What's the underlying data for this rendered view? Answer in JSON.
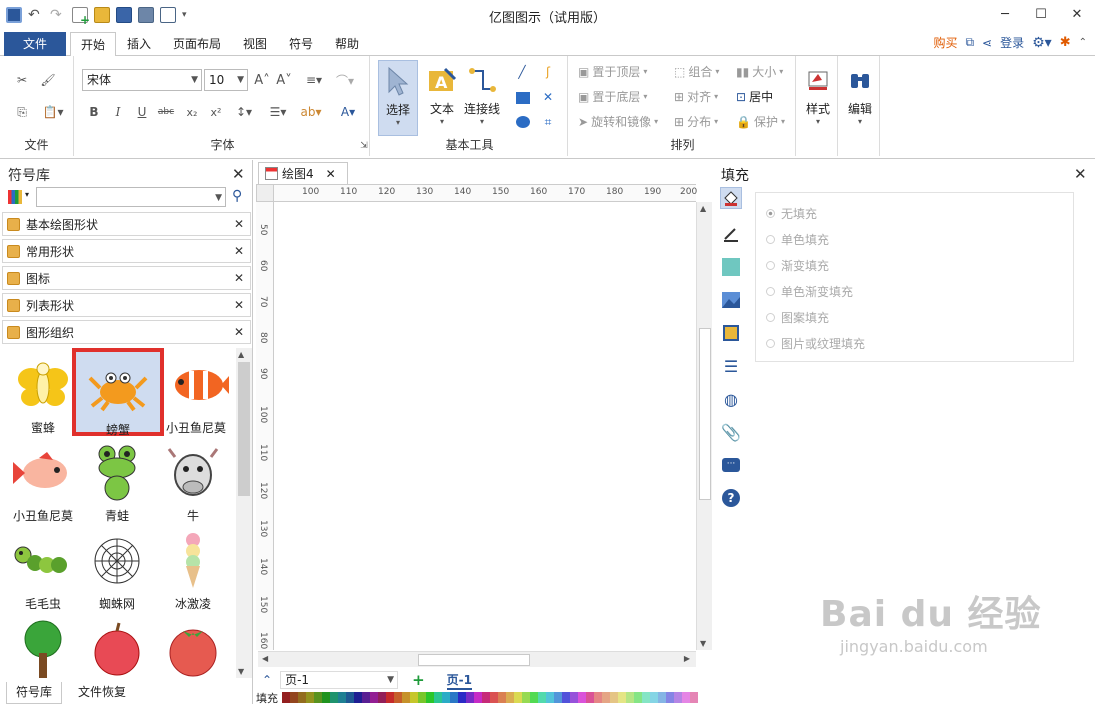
{
  "app": {
    "title": "亿图图示（试用版）"
  },
  "tabs": {
    "file": "文件",
    "home": "开始",
    "insert": "插入",
    "layout": "页面布局",
    "view": "视图",
    "symbol": "符号",
    "help": "帮助"
  },
  "topright": {
    "buy": "购买",
    "login": "登录"
  },
  "ribbon": {
    "file_group": "文件",
    "font_group": "字体",
    "font_name": "宋体",
    "font_size": "10",
    "basic_group": "基本工具",
    "select": "选择",
    "text": "文本",
    "connector": "连接线",
    "arrange_group": "排列",
    "bring_front": "置于顶层",
    "send_back": "置于底层",
    "rotate_mirror": "旋转和镜像",
    "group": "组合",
    "align": "对齐",
    "distribute": "分布",
    "size": "大小",
    "center": "居中",
    "protect": "保护",
    "style": "样式",
    "edit": "编辑"
  },
  "library": {
    "title": "符号库",
    "search_value": "",
    "sections": [
      "基本绘图形状",
      "常用形状",
      "图标",
      "列表形状",
      "图形组织"
    ],
    "shapes": [
      "蜜蜂",
      "螃蟹",
      "小丑鱼尼莫",
      "小丑鱼尼莫",
      "青蛙",
      "牛",
      "毛毛虫",
      "蜘蛛网",
      "冰激凌",
      "",
      "",
      ""
    ],
    "selected_index": 1,
    "bottom_tabs": [
      "符号库",
      "文件恢复"
    ]
  },
  "document": {
    "tab": "绘图4",
    "page_combo": "页-1",
    "page_tab": "页-1",
    "fill_label": "填充",
    "hruler": [
      "100",
      "110",
      "120",
      "130",
      "140",
      "150",
      "160",
      "170",
      "180",
      "190",
      "200"
    ],
    "vruler": [
      "50",
      "60",
      "70",
      "80",
      "90",
      "100",
      "110",
      "120",
      "130",
      "140",
      "150",
      "160"
    ]
  },
  "fill_panel": {
    "title": "填充",
    "options": [
      "无填充",
      "单色填充",
      "渐变填充",
      "单色渐变填充",
      "图案填充",
      "图片或纹理填充"
    ],
    "selected": 0
  },
  "watermark": {
    "line1": "Bai du 经验",
    "line2": "jingyan.baidu.com"
  },
  "colors": {
    "accent": "#2b579a",
    "highlight": "#e0302c",
    "selection_bg": "#cfdcf0"
  }
}
